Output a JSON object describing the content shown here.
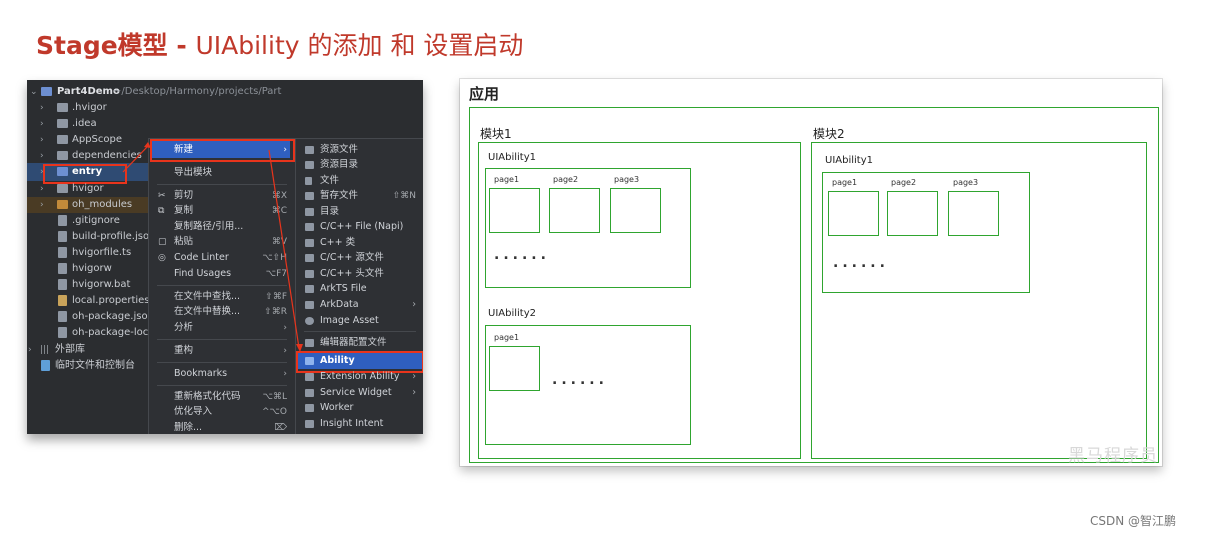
{
  "title": {
    "prefix": "Stage模型 - ",
    "rest": "UIAbility 的添加 和 设置启动"
  },
  "ide": {
    "project": {
      "name": "Part4Demo",
      "path": "~/Desktop/Harmony/projects/Part"
    },
    "tree": [
      {
        "label": ".hvigor"
      },
      {
        "label": ".idea"
      },
      {
        "label": "AppScope"
      },
      {
        "label": "dependencies"
      },
      {
        "label": "entry"
      },
      {
        "label": "hvigor"
      },
      {
        "label": "oh_modules"
      },
      {
        "label": ".gitignore"
      },
      {
        "label": "build-profile.jso"
      },
      {
        "label": "hvigorfile.ts"
      },
      {
        "label": "hvigorw"
      },
      {
        "label": "hvigorw.bat"
      },
      {
        "label": "local.properties"
      },
      {
        "label": "oh-package.jsor"
      },
      {
        "label": "oh-package-locl"
      },
      {
        "label": "外部库"
      },
      {
        "label": "临时文件和控制台"
      }
    ],
    "context_menu": [
      {
        "label": "新建",
        "shortcut": "›"
      },
      {
        "label": "导出模块",
        "shortcut": ""
      },
      {
        "label": "剪切",
        "shortcut": "⌘X"
      },
      {
        "label": "复制",
        "shortcut": "⌘C"
      },
      {
        "label": "复制路径/引用...",
        "shortcut": ""
      },
      {
        "label": "粘贴",
        "shortcut": "⌘V"
      },
      {
        "label": "Code Linter",
        "shortcut": "⌥⇧H"
      },
      {
        "label": "Find Usages",
        "shortcut": "⌥F7"
      },
      {
        "label": "在文件中查找...",
        "shortcut": "⇧⌘F"
      },
      {
        "label": "在文件中替换...",
        "shortcut": "⇧⌘R"
      },
      {
        "label": "分析",
        "shortcut": "›"
      },
      {
        "label": "重构",
        "shortcut": "›"
      },
      {
        "label": "Bookmarks",
        "shortcut": "›"
      },
      {
        "label": "重新格式化代码",
        "shortcut": "⌥⌘L"
      },
      {
        "label": "优化导入",
        "shortcut": "^⌥O"
      },
      {
        "label": "删除...",
        "shortcut": "⌦"
      }
    ],
    "submenu": [
      {
        "label": "资源文件",
        "extra": ""
      },
      {
        "label": "资源目录",
        "extra": ""
      },
      {
        "label": "文件",
        "extra": ""
      },
      {
        "label": "暂存文件",
        "extra": "⇧⌘N"
      },
      {
        "label": "目录",
        "extra": ""
      },
      {
        "label": "C/C++ File (Napi)",
        "extra": ""
      },
      {
        "label": "C++ 类",
        "extra": ""
      },
      {
        "label": "C/C++ 源文件",
        "extra": ""
      },
      {
        "label": "C/C++ 头文件",
        "extra": ""
      },
      {
        "label": "ArkTS File",
        "extra": ""
      },
      {
        "label": "ArkData",
        "extra": "›"
      },
      {
        "label": "Image Asset",
        "extra": ""
      },
      {
        "label": "编辑器配置文件",
        "extra": ""
      },
      {
        "label": "Ability",
        "extra": ""
      },
      {
        "label": "Extension Ability",
        "extra": "›"
      },
      {
        "label": "Service Widget",
        "extra": "›"
      },
      {
        "label": "Worker",
        "extra": ""
      },
      {
        "label": "Insight Intent",
        "extra": ""
      }
    ]
  },
  "diagram": {
    "app_label": "应用",
    "module1": {
      "label": "模块1",
      "ability1": {
        "label": "UIAbility1",
        "pages": [
          "page1",
          "page2",
          "page3"
        ],
        "dots": "......"
      },
      "ability2": {
        "label": "UIAbility2",
        "pages": [
          "page1"
        ],
        "dots": "......"
      }
    },
    "module2": {
      "label": "模块2",
      "ability1": {
        "label": "UIAbility1",
        "pages": [
          "page1",
          "page2",
          "page3"
        ],
        "dots": "......"
      }
    },
    "watermark": "黑马程序员"
  },
  "credit": "CSDN @智江鹏",
  "colors": {
    "title": "#c0392b",
    "highlight_box": "#e8341c",
    "diagram_line": "#2fa52f",
    "menu_selected": "#2f5fbf"
  }
}
